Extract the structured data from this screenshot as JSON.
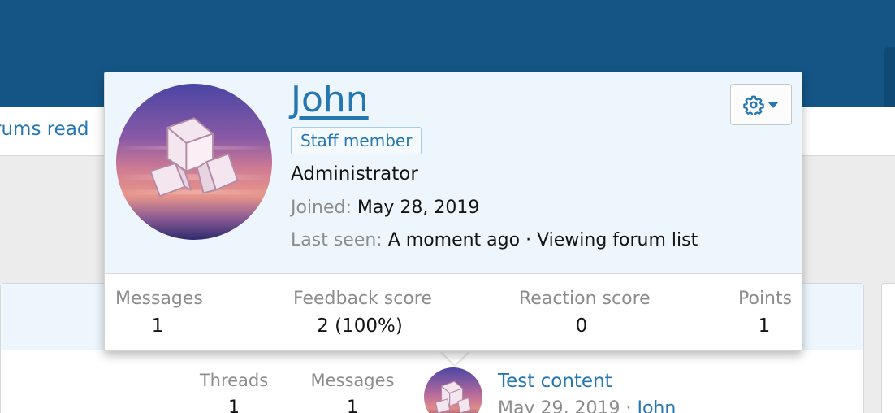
{
  "nav": {
    "link_label": "rums read"
  },
  "node": {
    "stats": [
      {
        "label": "Threads",
        "value": "1"
      },
      {
        "label": "Messages",
        "value": "1"
      }
    ],
    "latest": {
      "title": "Test content",
      "date": "May 29, 2019",
      "separator": "·",
      "user": "John"
    }
  },
  "tooltip": {
    "username": "John",
    "badge": "Staff member",
    "user_title": "Administrator",
    "joined_label": "Joined:",
    "joined_value": "May 28, 2019",
    "last_seen_label": "Last seen:",
    "last_seen_value": "A moment ago · Viewing forum list",
    "menu_icon": "gear-icon",
    "stats": [
      {
        "label": "Messages",
        "value": "1"
      },
      {
        "label": "Feedback score",
        "value": "2 (100%)"
      },
      {
        "label": "Reaction score",
        "value": "0"
      },
      {
        "label": "Points",
        "value": "1"
      }
    ]
  },
  "colors": {
    "header": "#145586",
    "link": "#2577b1",
    "tooltip_top": "#edf6fd",
    "muted": "#8c8c8c"
  }
}
